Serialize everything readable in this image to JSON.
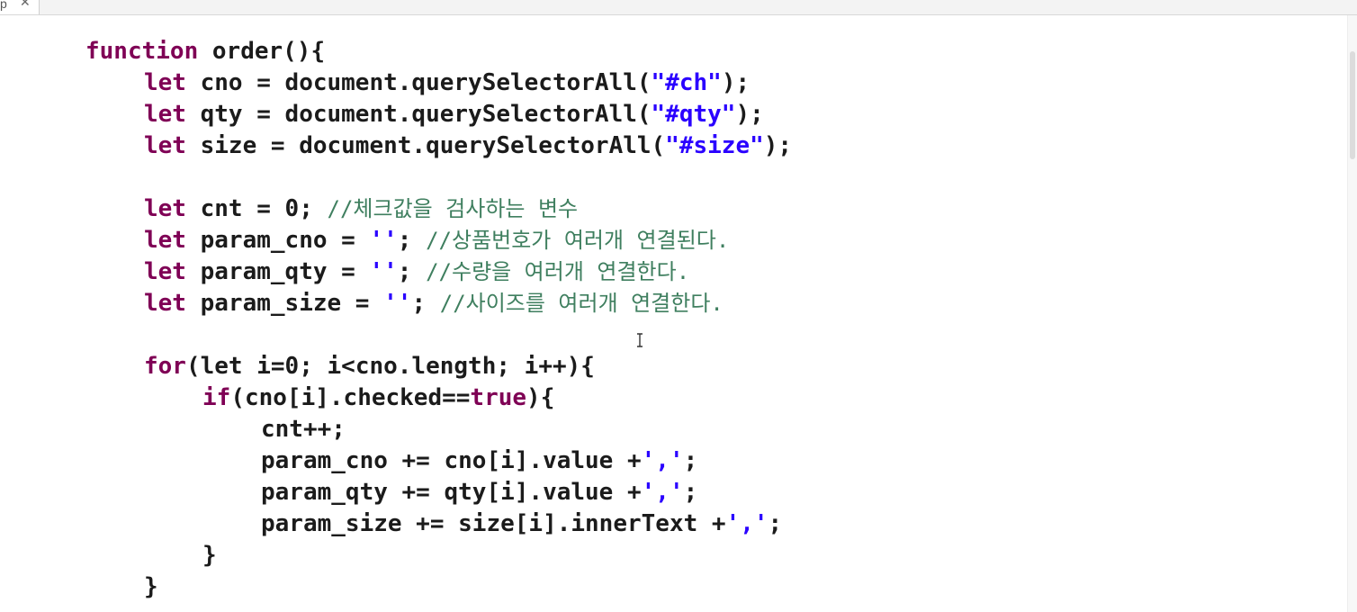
{
  "tab": {
    "label": "p",
    "close": "✕"
  },
  "code": {
    "l1": {
      "kw": "function",
      "rest": " order(){"
    },
    "l2": {
      "kw": "let",
      "a": " cno = document.querySelectorAll(",
      "str": "\"#ch\"",
      "b": ");"
    },
    "l3": {
      "kw": "let",
      "a": " qty = document.querySelectorAll(",
      "str": "\"#qty\"",
      "b": ");"
    },
    "l4": {
      "kw": "let",
      "a": " size = document.querySelectorAll(",
      "str": "\"#size\"",
      "b": ");"
    },
    "l6": {
      "kw": "let",
      "a": " cnt = 0; ",
      "cmt": "//체크값을 검사하는 변수"
    },
    "l7": {
      "kw": "let",
      "a": " param_cno = ",
      "str": "''",
      "b": "; ",
      "cmt": "//상품번호가 여러개 연결된다."
    },
    "l8": {
      "kw": "let",
      "a": " param_qty = ",
      "str": "''",
      "b": "; ",
      "cmt": "//수량을 여러개 연결한다."
    },
    "l9": {
      "kw": "let",
      "a": " param_size = ",
      "str": "''",
      "b": "; ",
      "cmt": "//사이즈를 여러개 연결한다."
    },
    "l11": {
      "kw": "for",
      "a": "(",
      "kw2": "let",
      "b": " i=0; i<cno.length; i++){"
    },
    "l12": {
      "kw": "if",
      "a": "(cno[i].checked==",
      "kw2": "true",
      "b": "){"
    },
    "l13": {
      "a": "cnt++;"
    },
    "l14": {
      "a": "param_cno += cno[i].value +",
      "str": "','",
      "b": ";"
    },
    "l15": {
      "a": "param_qty += qty[i].value +",
      "str": "','",
      "b": ";"
    },
    "l16": {
      "a": "param_size += size[i].innerText +",
      "str": "','",
      "b": ";"
    },
    "l17": {
      "a": "}"
    },
    "l18": {
      "a": "}"
    }
  },
  "colors": {
    "keyword": "#7f0055",
    "string": "#2a00ff",
    "comment": "#3f7f5f",
    "text": "#1b1b1b"
  }
}
